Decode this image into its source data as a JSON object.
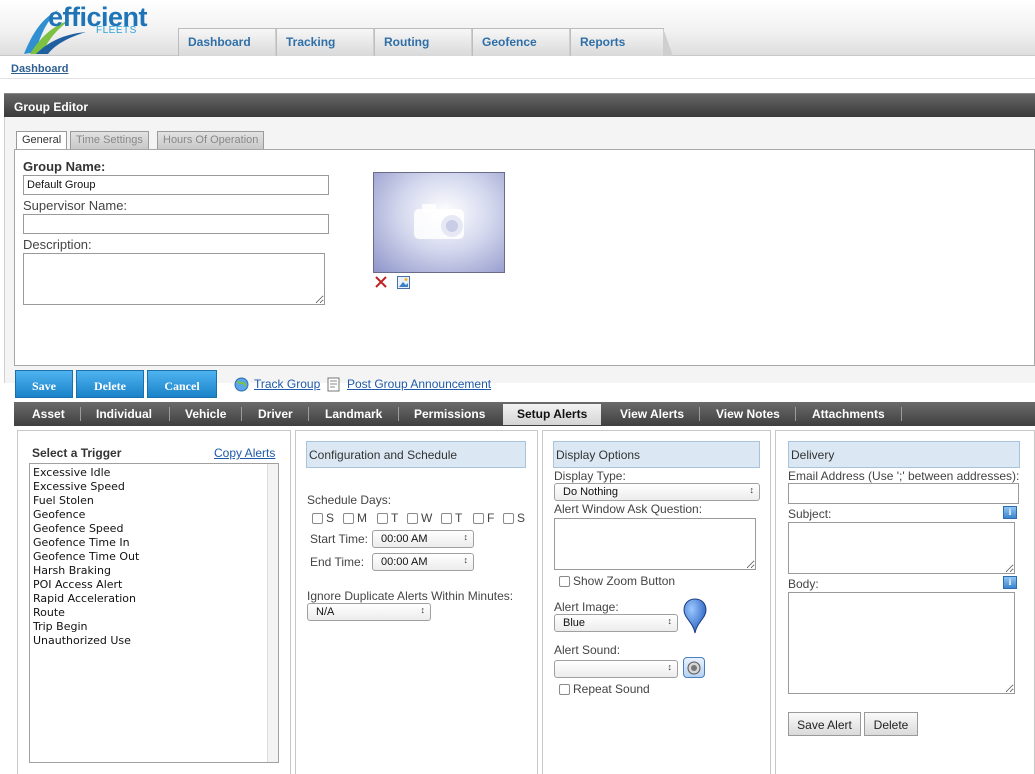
{
  "brand": {
    "name": "efficient",
    "sub": "FLEETS"
  },
  "nav": [
    "Dashboard",
    "Tracking",
    "Routing",
    "Geofence",
    "Reports"
  ],
  "breadcrumb": "Dashboard",
  "panel_title": "Group Editor",
  "subtabs": [
    "General",
    "Time Settings",
    "Hours Of Operation"
  ],
  "form": {
    "group_name_label": "Group Name:",
    "group_name_value": "Default Group",
    "supervisor_label": "Supervisor Name:",
    "supervisor_value": "",
    "description_label": "Description:",
    "description_value": ""
  },
  "buttons": {
    "save": "Save",
    "delete": "Delete",
    "cancel": "Cancel"
  },
  "links": {
    "track_group": "Track Group",
    "post_announcement": "Post Group Announcement"
  },
  "main_tabs": [
    "Asset",
    "Individual",
    "Vehicle",
    "Driver",
    "Landmark",
    "Permissions",
    "Setup Alerts",
    "View Alerts",
    "View Notes",
    "Attachments"
  ],
  "trigger": {
    "title": "Select a Trigger",
    "copy_link": "Copy Alerts",
    "items": [
      "Excessive Idle",
      "Excessive Speed",
      "Fuel Stolen",
      "Geofence",
      "Geofence Speed",
      "Geofence Time In",
      "Geofence Time Out",
      "Harsh Braking",
      "POI Access Alert",
      "Rapid Acceleration",
      "Route",
      "Trip Begin",
      "Unauthorized Use"
    ]
  },
  "config": {
    "header": "Configuration and Schedule",
    "schedule_label": "Schedule Days:",
    "days": [
      "S",
      "M",
      "T",
      "W",
      "T",
      "F",
      "S"
    ],
    "start_label": "Start Time:",
    "start_value": "00:00 AM",
    "end_label": "End Time:",
    "end_value": "00:00 AM",
    "ignore_label": "Ignore Duplicate Alerts Within Minutes:",
    "ignore_value": "N/A"
  },
  "display": {
    "header": "Display Options",
    "type_label": "Display Type:",
    "type_value": "Do Nothing",
    "ask_label": "Alert Window Ask Question:",
    "zoom_label": "Show Zoom Button",
    "image_label": "Alert Image:",
    "image_value": "Blue",
    "sound_label": "Alert Sound:",
    "sound_value": "",
    "repeat_label": "Repeat Sound",
    "pin_color": "#3f7fd6"
  },
  "delivery": {
    "header": "Delivery",
    "email_label": "Email Address (Use ';' between addresses):",
    "subject_label": "Subject:",
    "body_label": "Body:",
    "save_alert": "Save Alert",
    "delete": "Delete"
  }
}
